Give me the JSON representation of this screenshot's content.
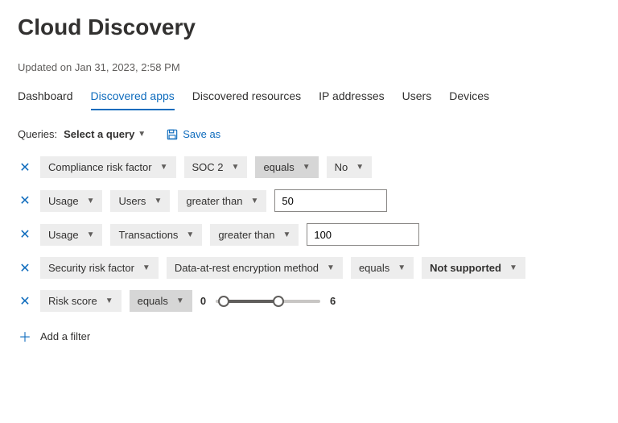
{
  "title": "Cloud Discovery",
  "updated": "Updated on Jan 31, 2023, 2:58 PM",
  "tabs": [
    {
      "label": "Dashboard"
    },
    {
      "label": "Discovered apps"
    },
    {
      "label": "Discovered resources"
    },
    {
      "label": "IP addresses"
    },
    {
      "label": "Users"
    },
    {
      "label": "Devices"
    }
  ],
  "active_tab_index": 1,
  "queries": {
    "label": "Queries:",
    "select_label": "Select a query",
    "save_as": "Save as"
  },
  "filters": [
    {
      "field": "Compliance risk factor",
      "subfield": "SOC 2",
      "op": "equals",
      "op_dark": true,
      "value": "No",
      "value_type": "chip"
    },
    {
      "field": "Usage",
      "subfield": "Users",
      "op": "greater than",
      "op_dark": false,
      "value": "50",
      "value_type": "input"
    },
    {
      "field": "Usage",
      "subfield": "Transactions",
      "op": "greater than",
      "op_dark": false,
      "value": "100",
      "value_type": "input"
    },
    {
      "field": "Security risk factor",
      "subfield": "Data-at-rest encryption method",
      "op": "equals",
      "op_dark": false,
      "value": "Not supported",
      "value_bold": true,
      "value_type": "chip"
    },
    {
      "field": "Risk score",
      "op": "equals",
      "op_dark": true,
      "value_type": "slider",
      "slider_min": 0,
      "slider_max": 6
    }
  ],
  "add_filter": "Add a filter"
}
